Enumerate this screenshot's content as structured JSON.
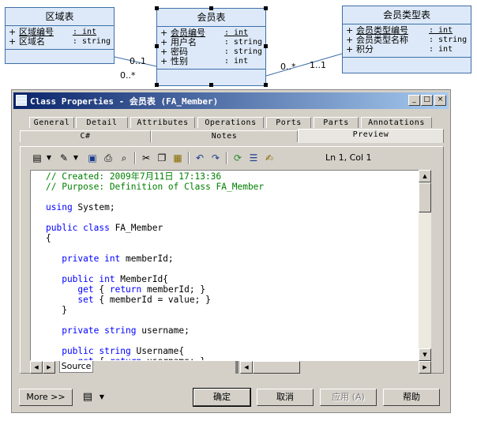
{
  "diagram": {
    "region": {
      "title": "区域表",
      "attrs": [
        {
          "vis": "+",
          "name": "区域编号",
          "type": ": int",
          "pk": true
        },
        {
          "vis": "+",
          "name": "区域名",
          "type": ": string",
          "pk": false
        }
      ]
    },
    "member": {
      "title": "会员表",
      "attrs": [
        {
          "vis": "+",
          "name": "会员编号",
          "type": ": int",
          "pk": true
        },
        {
          "vis": "+",
          "name": "用户名",
          "type": ": string",
          "pk": false
        },
        {
          "vis": "+",
          "name": "密码",
          "type": ": string",
          "pk": false
        },
        {
          "vis": "+",
          "name": "性别",
          "type": ": int",
          "pk": false
        }
      ]
    },
    "membertype": {
      "title": "会员类型表",
      "attrs": [
        {
          "vis": "+",
          "name": "会员类型编号",
          "type": ": int",
          "pk": true
        },
        {
          "vis": "+",
          "name": "会员类型名称",
          "type": ": string",
          "pk": false
        },
        {
          "vis": "+",
          "name": "积分",
          "type": ": int",
          "pk": false
        }
      ]
    },
    "multiplicities": {
      "left_region_side": "0..1",
      "left_member_side": "0..*",
      "right_member_side": "0..*",
      "right_type_side": "1..1"
    }
  },
  "dialog": {
    "title": "Class Properties - 会员表 (FA_Member)",
    "window_buttons": {
      "minimize": "_",
      "maximize": "□",
      "close": "×"
    },
    "tabs_row1": [
      "General",
      "Detail",
      "Attributes",
      "Operations",
      "Ports",
      "Parts",
      "Annotations"
    ],
    "tabs_row2": [
      "C#",
      "Notes",
      "Preview"
    ],
    "active_tab": "Preview",
    "cursor_position": "Ln 1, Col 1",
    "source_tab": "Source",
    "code_lines": [
      {
        "k": "cm",
        "t": "// Created: 2009年7月11日 17:13:36"
      },
      {
        "k": "cm",
        "t": "// Purpose: Definition of Class FA_Member"
      },
      {
        "k": "tx",
        "t": ""
      },
      {
        "parts": [
          {
            "k": "kw",
            "t": "using"
          },
          {
            "k": "tx",
            "t": " System;"
          }
        ]
      },
      {
        "k": "tx",
        "t": ""
      },
      {
        "parts": [
          {
            "k": "kw",
            "t": "public class"
          },
          {
            "k": "tx",
            "t": " FA_Member"
          }
        ]
      },
      {
        "k": "tx",
        "t": "{"
      },
      {
        "k": "tx",
        "t": ""
      },
      {
        "parts": [
          {
            "k": "kw",
            "t": "   private int"
          },
          {
            "k": "tx",
            "t": " memberId;"
          }
        ]
      },
      {
        "k": "tx",
        "t": ""
      },
      {
        "parts": [
          {
            "k": "kw",
            "t": "   public int"
          },
          {
            "k": "tx",
            "t": " MemberId{"
          }
        ]
      },
      {
        "parts": [
          {
            "k": "kw",
            "t": "      get"
          },
          {
            "k": "tx",
            "t": " { "
          },
          {
            "k": "kw",
            "t": "return"
          },
          {
            "k": "tx",
            "t": " memberId; }"
          }
        ]
      },
      {
        "parts": [
          {
            "k": "kw",
            "t": "      set"
          },
          {
            "k": "tx",
            "t": " { memberId = value; }"
          }
        ]
      },
      {
        "k": "tx",
        "t": "   }"
      },
      {
        "k": "tx",
        "t": ""
      },
      {
        "parts": [
          {
            "k": "kw",
            "t": "   private string"
          },
          {
            "k": "tx",
            "t": " username;"
          }
        ]
      },
      {
        "k": "tx",
        "t": ""
      },
      {
        "parts": [
          {
            "k": "kw",
            "t": "   public string"
          },
          {
            "k": "tx",
            "t": " Username{"
          }
        ]
      },
      {
        "parts": [
          {
            "k": "kw",
            "t": "      get"
          },
          {
            "k": "tx",
            "t": " { "
          },
          {
            "k": "kw",
            "t": "return"
          },
          {
            "k": "tx",
            "t": " username; }"
          }
        ]
      }
    ],
    "buttons": {
      "more": "More >>",
      "ok": "确定",
      "cancel": "取消",
      "apply": "应用 (A)",
      "help": "帮助"
    }
  }
}
